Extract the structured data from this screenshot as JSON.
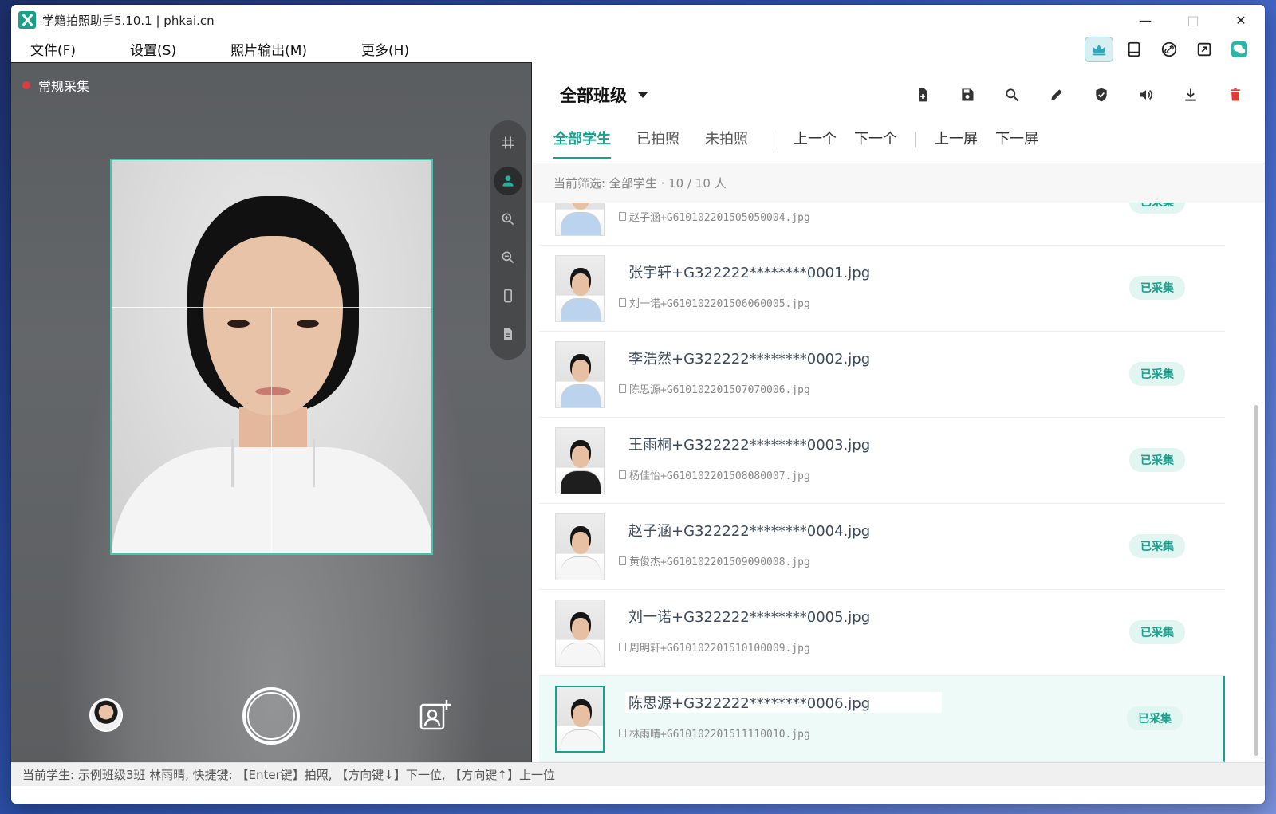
{
  "window": {
    "title": "学籍拍照助手5.10.1 | phkai.cn",
    "minimize": "—",
    "maximize": "□",
    "close": "✕"
  },
  "menu": [
    "文件(F)",
    "设置(S)",
    "照片输出(M)",
    "更多(H)"
  ],
  "top_tools": [
    "crown-icon",
    "tablet-icon",
    "link-icon",
    "export-icon",
    "wechat-icon"
  ],
  "camera": {
    "mode_label": "常规采集",
    "tools": [
      "grid-icon",
      "person-icon",
      "zoom-in-icon",
      "zoom-out-icon",
      "phone-icon",
      "document-icon"
    ]
  },
  "panel": {
    "class_select": "全部班级",
    "actions": [
      "add-file-icon",
      "save-icon",
      "search-icon",
      "edit-icon",
      "shield-icon",
      "speaker-icon",
      "download-icon",
      "delete-icon"
    ],
    "tabs": [
      "全部学生",
      "已拍照",
      "未拍照"
    ],
    "nav": [
      "上一个",
      "下一个",
      "上一屏",
      "下一屏"
    ],
    "filter": "当前筛选: 全部学生 · 10 / 10 人"
  },
  "rows": [
    {
      "filename": "",
      "subname": "赵子涵+G610102201505050004.jpg",
      "badge": "已采集",
      "photo": "blue"
    },
    {
      "filename": "张宇轩+G322222********0001.jpg",
      "subname": "刘一诺+G610102201506060005.jpg",
      "badge": "已采集",
      "photo": "blue"
    },
    {
      "filename": "李浩然+G322222********0002.jpg",
      "subname": "陈思源+G610102201507070006.jpg",
      "badge": "已采集",
      "photo": "blue"
    },
    {
      "filename": "王雨桐+G322222********0003.jpg",
      "subname": "杨佳怡+G610102201508080007.jpg",
      "badge": "已采集",
      "photo": "dark"
    },
    {
      "filename": "赵子涵+G322222********0004.jpg",
      "subname": "黄俊杰+G610102201509090008.jpg",
      "badge": "已采集",
      "photo": "white"
    },
    {
      "filename": "刘一诺+G322222********0005.jpg",
      "subname": "周明轩+G610102201510100009.jpg",
      "badge": "已采集",
      "photo": "white"
    },
    {
      "filename": "陈思源+G322222********0006.jpg",
      "subname": "林雨晴+G610102201511110010.jpg",
      "badge": "已采集",
      "photo": "white"
    }
  ],
  "status": "当前学生: 示例班级3班 林雨晴, 快捷键: 【Enter键】拍照, 【方向键↓】下一位, 【方向键↑】上一位",
  "colors": {
    "accent": "#14a38f",
    "badge_bg": "#e2f6f1",
    "delete": "#e53935"
  }
}
